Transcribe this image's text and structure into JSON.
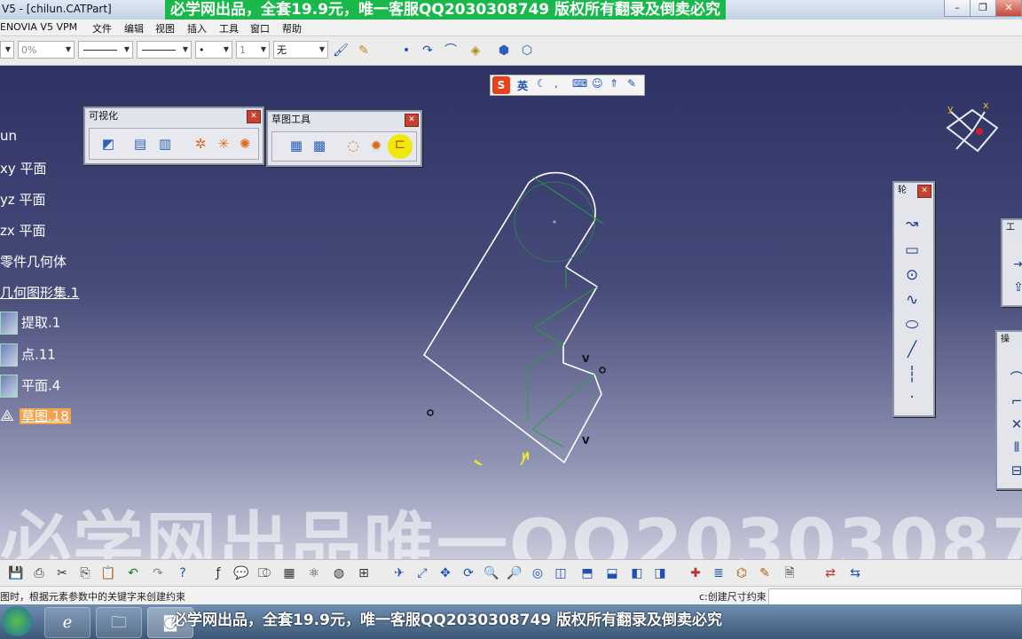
{
  "window": {
    "title": "V5 - [chilun.CATPart]",
    "minimize": "–",
    "restore": "❐",
    "close": "✕"
  },
  "watermark_top": "必学网出品，全套19.9元，唯一客服QQ2030308749 版权所有翻录及倒卖必究",
  "watermark_big": "必学网出品唯一QQ2030308749",
  "watermark_bottom": "必学网出品，全套19.9元，唯一客服QQ2030308749 版权所有翻录及倒卖必究",
  "menu": [
    "ENOVIA V5 VPM",
    "文件",
    "编辑",
    "视图",
    "插入",
    "工具",
    "窗口",
    "帮助"
  ],
  "toolbar": {
    "transparency": "0%",
    "layer": "无",
    "thickness": "1",
    "point": "•"
  },
  "ime_bar": {
    "logo": "S",
    "mode": "英"
  },
  "tree": {
    "items": [
      {
        "label": "un"
      },
      {
        "label": "xy 平面"
      },
      {
        "label": "yz 平面"
      },
      {
        "label": "zx 平面"
      },
      {
        "label": "零件几何体"
      },
      {
        "label": "几何图形集.1"
      },
      {
        "label": "提取.1"
      },
      {
        "label": "点.11"
      },
      {
        "label": "平面.4"
      },
      {
        "label": "草图.18"
      }
    ]
  },
  "panels": {
    "visualization": {
      "title": "可视化"
    },
    "sketch_tools": {
      "title": "草图工具"
    },
    "profile": {
      "title": "轮"
    },
    "tools": {
      "title": "工"
    },
    "operation": {
      "title": "操"
    }
  },
  "status": {
    "left": "图时，根据元素参数中的关键字来创建约束",
    "right": "c:创建尺寸约束"
  },
  "compass": {
    "x_label": "x",
    "y_label": "y"
  },
  "sketch_labels": {
    "v1": "V",
    "v2": "V",
    "v3": "V",
    "h": "H"
  },
  "colors": {
    "viewport_top": "#2e3263",
    "sketch_line": "#ffffff",
    "constraint": "#1fa832",
    "highlight": "#f2a34b"
  }
}
